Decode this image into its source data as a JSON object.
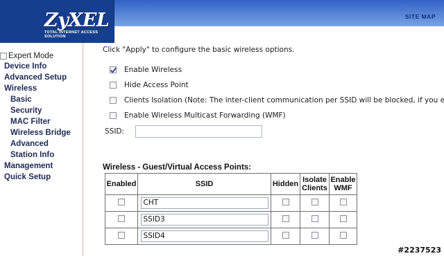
{
  "brand": {
    "logo": "ZyXEL",
    "tagline": "Total Internet Access Solution"
  },
  "header": {
    "site_map": "SITE MAP"
  },
  "sidebar": {
    "expert_mode": {
      "label": "Expert Mode",
      "checked": false
    },
    "items": [
      {
        "label": "Device Info",
        "level": 0
      },
      {
        "label": "Advanced Setup",
        "level": 0
      },
      {
        "label": "Wireless",
        "level": 0
      },
      {
        "label": "Basic",
        "level": 1
      },
      {
        "label": "Security",
        "level": 1
      },
      {
        "label": "MAC Filter",
        "level": 1
      },
      {
        "label": "Wireless Bridge",
        "level": 1
      },
      {
        "label": "Advanced",
        "level": 1
      },
      {
        "label": "Station Info",
        "level": 1
      },
      {
        "label": "Management",
        "level": 0
      },
      {
        "label": "Quick Setup",
        "level": 0
      }
    ]
  },
  "main": {
    "intro": "Click \"Apply\" to configure the basic wireless options.",
    "options": [
      {
        "label": "Enable Wireless",
        "checked": true
      },
      {
        "label": "Hide Access Point",
        "checked": false
      },
      {
        "label": "Clients Isolation (Note: The inter-client communication per SSID will be blocked, if you enable the f",
        "checked": false
      },
      {
        "label": "Enable Wireless Multicast Forwarding (WMF)",
        "checked": false
      }
    ],
    "ssid": {
      "label": "SSID:",
      "value": ""
    },
    "guest_section": {
      "title": "Wireless - Guest/Virtual Access Points:",
      "columns": [
        "Enabled",
        "SSID",
        "Hidden",
        "Isolate Clients",
        "Enable WMF"
      ],
      "rows": [
        {
          "enabled": false,
          "ssid": "CHT",
          "hidden": false,
          "isolate": false,
          "wmf": false
        },
        {
          "enabled": false,
          "ssid": "SSID3",
          "hidden": false,
          "isolate": false,
          "wmf": false
        },
        {
          "enabled": false,
          "ssid": "SSID4",
          "hidden": false,
          "isolate": false,
          "wmf": false
        }
      ]
    }
  },
  "watermark": "#2237523",
  "colors": {
    "brand_blue": "#163e8e",
    "header_gradient_top": "#2f62c6",
    "header_gradient_bottom": "#7aa2e2",
    "nav_text": "#1d2a55"
  }
}
